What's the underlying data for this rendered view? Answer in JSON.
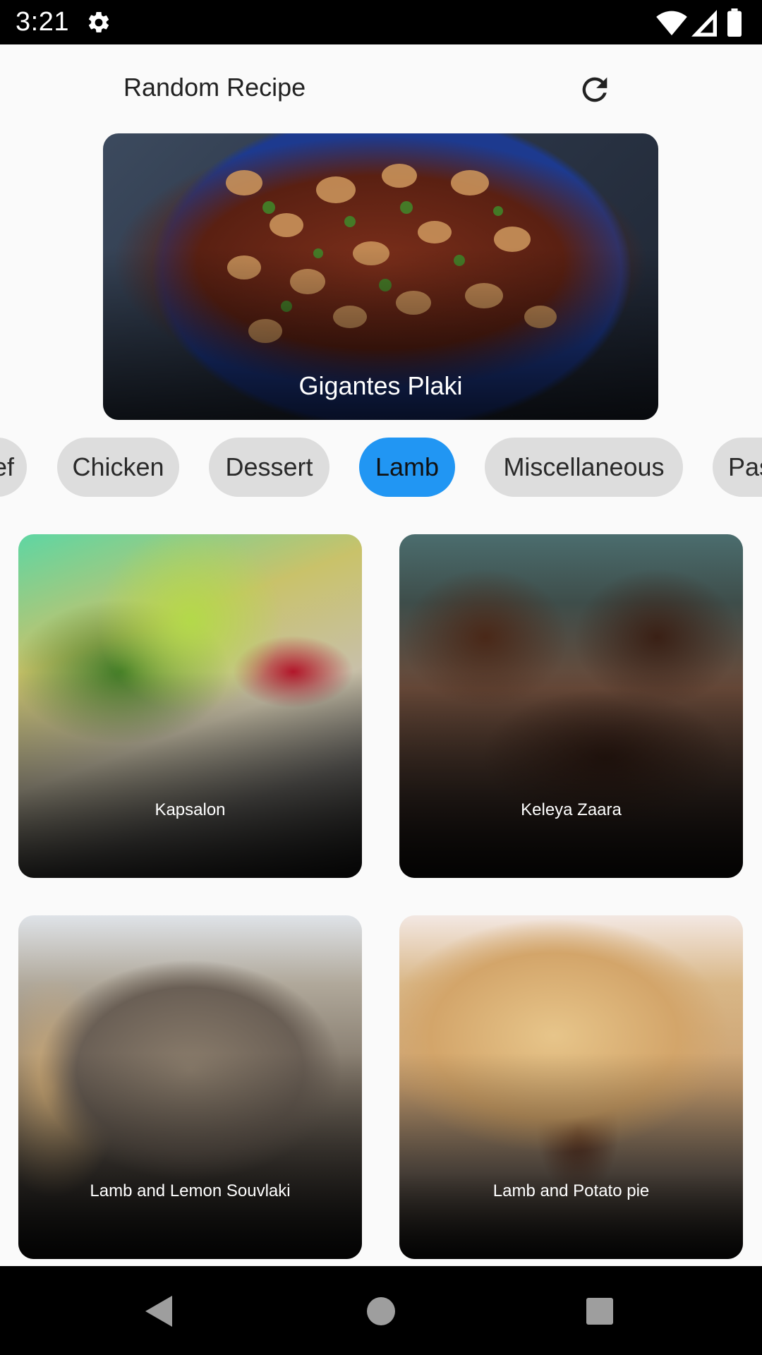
{
  "status_bar": {
    "time": "3:21"
  },
  "appbar": {
    "title": "Random Recipe"
  },
  "hero": {
    "title": "Gigantes Plaki"
  },
  "categories": [
    {
      "label": "Beef",
      "selected": false
    },
    {
      "label": "Chicken",
      "selected": false
    },
    {
      "label": "Dessert",
      "selected": false
    },
    {
      "label": "Lamb",
      "selected": true
    },
    {
      "label": "Miscellaneous",
      "selected": false
    },
    {
      "label": "Pasta",
      "selected": false
    }
  ],
  "recipes": [
    {
      "title": "Kapsalon"
    },
    {
      "title": "Keleya Zaara"
    },
    {
      "title": "Lamb and Lemon Souvlaki"
    },
    {
      "title": "Lamb and Potato pie"
    }
  ],
  "colors": {
    "chip_selected": "#2196f3",
    "chip_default": "#dddddd",
    "background": "#fafafa"
  }
}
